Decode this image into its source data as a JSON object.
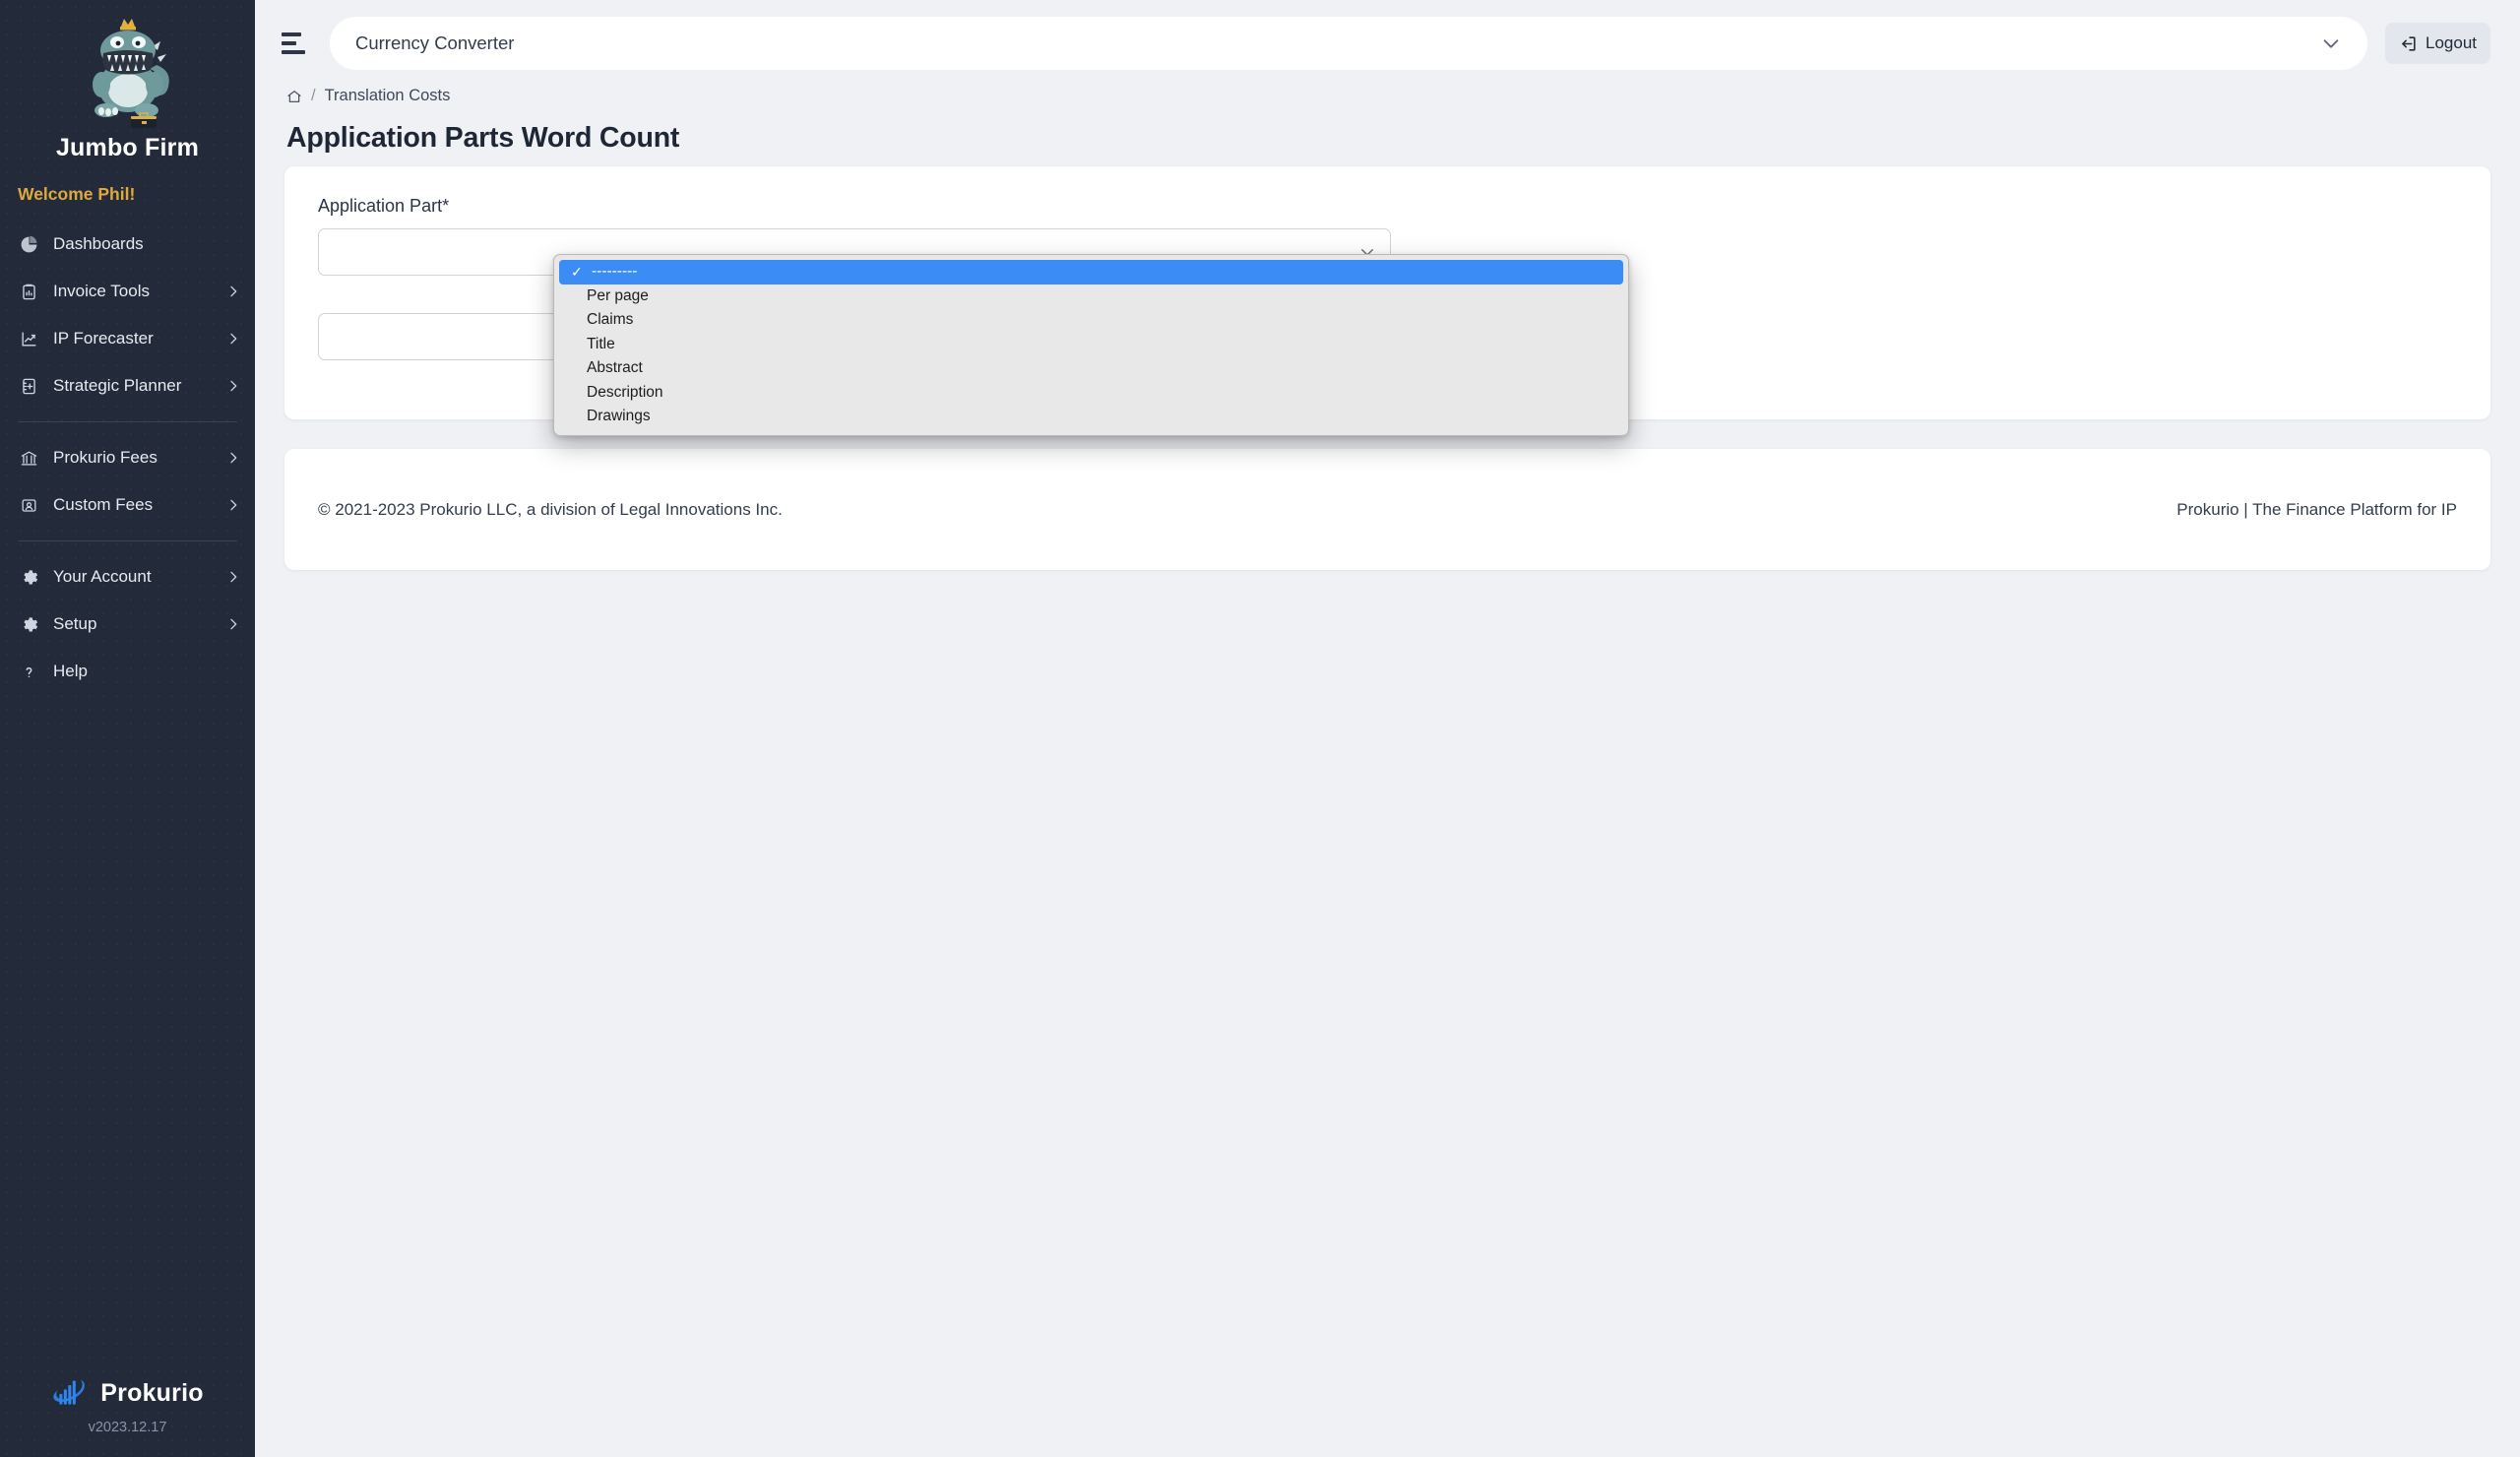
{
  "sidebar": {
    "logo_icon": "jumbo-mascot-logo",
    "brand_name": "Jumbo Firm",
    "welcome": "Welcome Phil!",
    "items": [
      {
        "label": "Dashboards",
        "icon": "pie-chart-icon",
        "has_chevron": false
      },
      {
        "label": "Invoice Tools",
        "icon": "clipboard-chart-icon",
        "has_chevron": true
      },
      {
        "label": "IP Forecaster",
        "icon": "trend-chart-icon",
        "has_chevron": true
      },
      {
        "label": "Strategic Planner",
        "icon": "notebook-plus-icon",
        "has_chevron": true
      },
      {
        "label": "Prokurio Fees",
        "icon": "bank-icon",
        "has_chevron": true
      },
      {
        "label": "Custom Fees",
        "icon": "id-card-icon",
        "has_chevron": true
      },
      {
        "label": "Your Account",
        "icon": "gear-icon",
        "has_chevron": true
      },
      {
        "label": "Setup",
        "icon": "gear-icon",
        "has_chevron": true
      },
      {
        "label": "Help",
        "icon": "question-mark-icon",
        "has_chevron": false
      }
    ],
    "footer": {
      "logo_icon": "prokurio-bars-orbit-logo",
      "brand": "Prokurio",
      "version": "v2023.12.17"
    }
  },
  "topbar": {
    "menu_icon": "hamburger-menu-icon",
    "app_select_value": "Currency Converter",
    "app_select_chevron_icon": "chevron-down-icon",
    "logout_label": "Logout",
    "logout_icon": "sign-out-icon"
  },
  "breadcrumb": {
    "home_icon": "home-icon",
    "separator": "/",
    "current": "Translation Costs"
  },
  "page": {
    "title": "Application Parts Word Count"
  },
  "form": {
    "field_label": "Application Part*",
    "select_value": "",
    "select_chevron_icon": "chevron-down-icon"
  },
  "dropdown": {
    "open": true,
    "selected_index": 0,
    "check_glyph": "✓",
    "options": [
      "---------",
      "Per page",
      "Claims",
      "Title",
      "Abstract",
      "Description",
      "Drawings"
    ]
  },
  "footer": {
    "copyright": "© 2021-2023 Prokurio LLC, a division of Legal Innovations Inc.",
    "tagline": "Prokurio | The Finance Platform for IP"
  },
  "colors": {
    "sidebar_bg": "#232b3b",
    "page_bg": "#eff1f5",
    "accent_gold": "#e0a93c",
    "highlight_blue": "#3b8cf5",
    "brand_blue": "#2e86f0"
  }
}
